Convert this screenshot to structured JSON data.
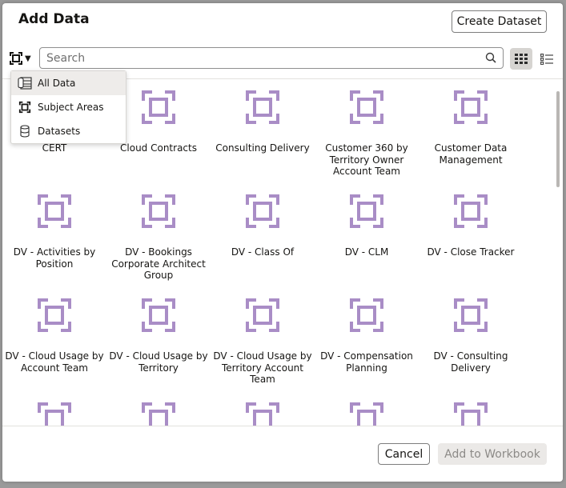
{
  "dialog": {
    "title": "Add Data",
    "create_label": "Create Dataset",
    "cancel_label": "Cancel",
    "add_label": "Add to Workbook"
  },
  "search": {
    "placeholder": "Search",
    "value": ""
  },
  "view_toggle": {
    "grid_selected": true
  },
  "menu": {
    "items": [
      {
        "label": "All Data",
        "icon": "all-data-icon",
        "selected": true
      },
      {
        "label": "Subject Areas",
        "icon": "subject-area-icon",
        "selected": false
      },
      {
        "label": "Datasets",
        "icon": "dataset-icon",
        "selected": false
      }
    ]
  },
  "items": [
    "CERT",
    "Cloud Contracts",
    "Consulting Delivery",
    "Customer 360 by Territory Owner Account Team",
    "Customer Data Management",
    "DV - Activities by Position",
    "DV - Bookings Corporate Architect Group",
    "DV - Class Of",
    "DV - CLM",
    "DV - Close Tracker",
    "DV - Cloud Usage by Account Team",
    "DV - Cloud Usage by Territory",
    "DV - Cloud Usage by Territory Account Team",
    "DV - Compensation Planning",
    "DV - Consulting Delivery",
    "",
    "",
    "",
    "",
    ""
  ],
  "colors": {
    "tile_icon": "#a98dc6",
    "accent_bg": "#d6d4d1"
  }
}
